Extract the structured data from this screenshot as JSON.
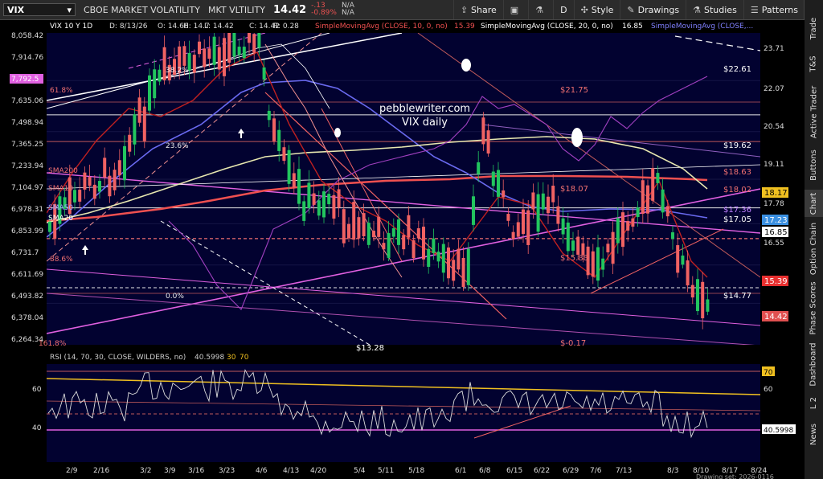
{
  "toolbar": {
    "symbol": "VIX",
    "description": "CBOE MARKET VOLATILITY",
    "short_desc": "MKT VLTILITY",
    "last_price": "14.42",
    "change": "-.13",
    "change_pct": "-0.89%",
    "bid": "N/A",
    "ask": "N/A",
    "share_label": "Share",
    "period_label": "D",
    "style_label": "Style",
    "drawings_label": "Drawings",
    "studies_label": "Studies",
    "patterns_label": "Patterns"
  },
  "sidebar": {
    "tabs": [
      "Trade",
      "T&S",
      "Active Trader",
      "Buttons",
      "Chart",
      "Option Chain",
      "Phase Scores",
      "Dashboard",
      "L 2",
      "News"
    ]
  },
  "chart": {
    "header": {
      "symbol_period": "VIX 10 Y 1D",
      "date": "D: 8/13/26",
      "open": "O: 14.68",
      "high": "H: 14.7",
      "low": "L: 14.42",
      "close": "C: 14.42",
      "range": "R: 0.28",
      "sma10": "SimpleMovingAvg (CLOSE, 10, 0, no)",
      "sma10_val": "15.39",
      "sma20": "SimpleMovingAvg (CLOSE, 20, 0, no)",
      "sma20_val": "16.85",
      "sma50": "SimpleMovingAvg (CLOSE,..."
    },
    "watermark": [
      "pebblewriter.com",
      "VIX daily"
    ],
    "left_axis": [
      "8,058.42",
      "7,914.76",
      "7,792.5",
      "7,635.06",
      "7,498.94",
      "7,365.25",
      "7,233.94",
      "7,104.97",
      "6,978.31",
      "6,853.99",
      "6,731.7",
      "6,611.69",
      "6,493.82",
      "6,378.04",
      "6,264.34"
    ],
    "right_axis": [
      "23.71",
      "22.07",
      "20.54",
      "19.11",
      "17.78",
      "16.55"
    ],
    "fib_labels": [
      "61.8%",
      "38.2%",
      "23.6%",
      "0.0%",
      "88.6%",
      "161.8%"
    ],
    "level_labels": [
      "$22.61",
      "$21.75",
      "$19.62",
      "$18.63",
      "$18.07",
      "$18.02",
      "$17.36",
      "$17.05",
      "$15.88",
      "$14.77",
      "$13.28",
      "$-0.17"
    ],
    "ma_labels": [
      "SMA200",
      "SMA10",
      "SMA50",
      "SMA20"
    ],
    "price_tags": [
      {
        "text": "18.17",
        "bg": "#f0c020",
        "fg": "#000000"
      },
      {
        "text": "17.23",
        "bg": "#3a8fe0",
        "fg": "#ffffff"
      },
      {
        "text": "16.85",
        "bg": "#ffffff",
        "fg": "#000000"
      },
      {
        "text": "15.39",
        "bg": "#e83030",
        "fg": "#ffffff"
      },
      {
        "text": "14.42",
        "bg": "#e05050",
        "fg": "#ffffff"
      }
    ],
    "date_axis": [
      "2/9",
      "2/16",
      "3/2",
      "3/9",
      "3/16",
      "3/23",
      "4/6",
      "4/13",
      "4/20",
      "5/4",
      "5/11",
      "5/18",
      "6/1",
      "6/8",
      "6/15",
      "6/22",
      "6/29",
      "7/6",
      "7/13",
      "8/3",
      "8/10",
      "8/17",
      "8/24"
    ],
    "drawing_set": "Drawing set: 2026-0116"
  },
  "rsi": {
    "header": "RSI (14, 70, 30, CLOSE, WILDERS, no)",
    "value": "40.5998",
    "ob": "30",
    "os": "70",
    "axis": [
      "60",
      "40"
    ],
    "right_axis": [
      "60"
    ],
    "tags": [
      {
        "text": "70",
        "bg": "#f0c020",
        "fg": "#000000"
      },
      {
        "text": "40.5998",
        "bg": "#ffffff",
        "fg": "#000000"
      }
    ]
  },
  "colors": {
    "panel_bg": "#020230",
    "up": "#22c55e",
    "down": "#f06262",
    "sma200": "#f05050",
    "sma50": "#6a6af0",
    "sma20": "#e8e8b0",
    "trend_magenta": "#e060e0"
  }
}
